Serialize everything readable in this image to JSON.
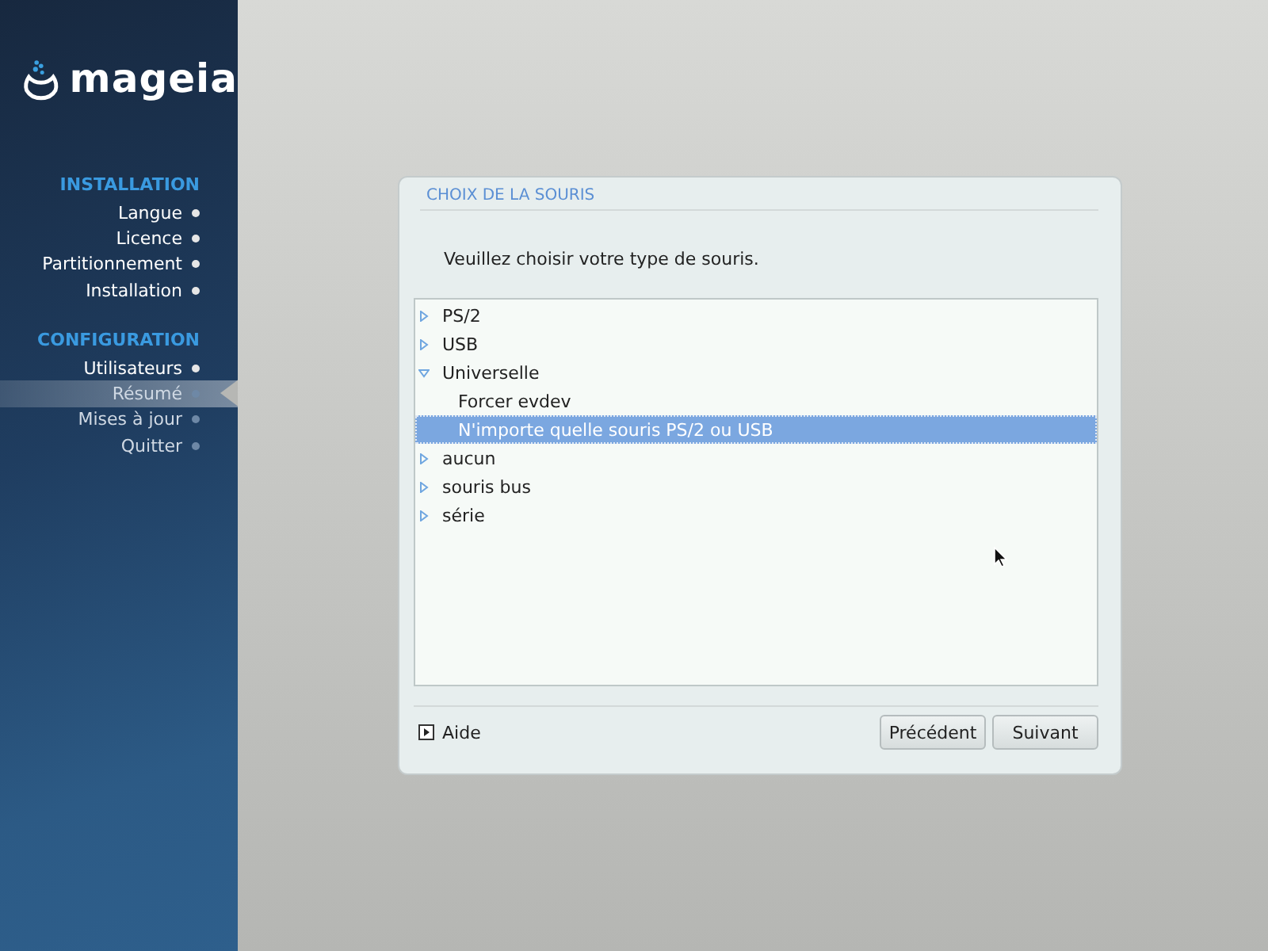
{
  "logo": {
    "wordmark": "mageia"
  },
  "sidebar": {
    "sections": [
      {
        "title": "INSTALLATION",
        "items": [
          {
            "label": "Langue",
            "selected": false,
            "completed": true
          },
          {
            "label": "Licence",
            "selected": false,
            "completed": true
          },
          {
            "label": "Partitionnement",
            "selected": false,
            "completed": true
          },
          {
            "label": "Installation",
            "selected": false,
            "completed": true
          }
        ]
      },
      {
        "title": "CONFIGURATION",
        "items": [
          {
            "label": "Utilisateurs",
            "selected": false,
            "completed": true
          },
          {
            "label": "Résumé",
            "selected": true,
            "completed": false
          },
          {
            "label": "Mises à jour",
            "selected": false,
            "completed": false
          },
          {
            "label": "Quitter",
            "selected": false,
            "completed": false
          }
        ]
      }
    ]
  },
  "dialog": {
    "title": "CHOIX DE LA SOURIS",
    "prompt": "Veuillez choisir votre type de souris.",
    "tree": [
      {
        "label": "PS/2",
        "expanded": false,
        "selected": false
      },
      {
        "label": "USB",
        "expanded": false,
        "selected": false
      },
      {
        "label": "Universelle",
        "expanded": true,
        "selected": false,
        "children": [
          {
            "label": "Forcer evdev",
            "selected": false
          },
          {
            "label": "N'importe quelle souris PS/2 ou USB",
            "selected": true
          }
        ]
      },
      {
        "label": "aucun",
        "expanded": false,
        "selected": false
      },
      {
        "label": "souris bus",
        "expanded": false,
        "selected": false
      },
      {
        "label": "série",
        "expanded": false,
        "selected": false
      }
    ],
    "help": {
      "label": "Aide",
      "expanded": false
    },
    "buttons": [
      "Précédent",
      "Suivant"
    ]
  }
}
